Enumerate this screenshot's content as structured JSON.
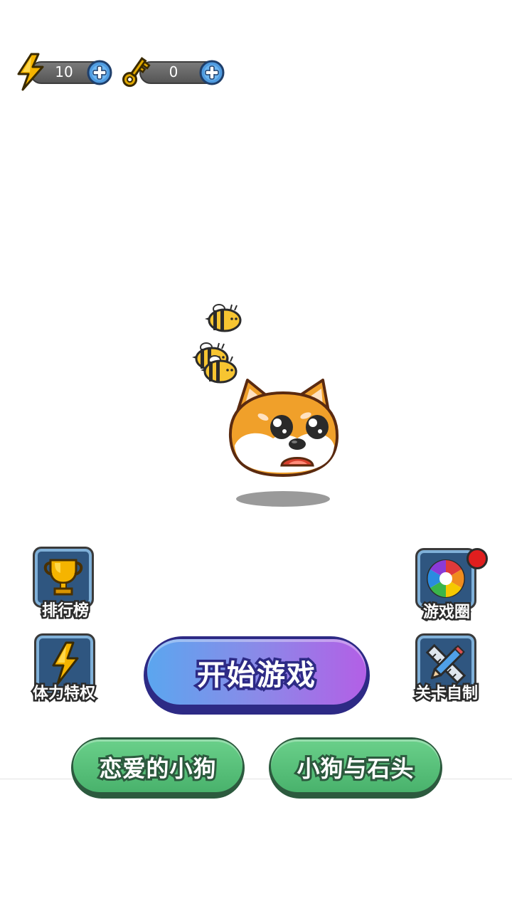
{
  "resources": {
    "energy": {
      "icon": "lightning-icon",
      "value": "10"
    },
    "keys": {
      "icon": "key-icon",
      "value": "0"
    }
  },
  "side_buttons": {
    "leaderboard": {
      "label": "排行榜",
      "icon": "trophy-icon"
    },
    "stamina": {
      "label": "体力特权",
      "icon": "lightning-icon"
    },
    "game_circle": {
      "label": "游戏圈",
      "icon": "aperture-icon",
      "has_notification": true
    },
    "level_editor": {
      "label": "关卡自制",
      "icon": "pencil-ruler-icon"
    }
  },
  "start_button": {
    "label": "开始游戏"
  },
  "mode_buttons": {
    "love_dog": {
      "label": "恋爱的小狗"
    },
    "dog_and_stone": {
      "label": "小狗与石头"
    }
  },
  "scene": {
    "character": "shiba-dog",
    "bees": 3
  },
  "colors": {
    "start_gradient": [
      "#5ba6ef",
      "#b35fe6"
    ],
    "green": "#4fbf74",
    "notification": "#e01e1e"
  }
}
